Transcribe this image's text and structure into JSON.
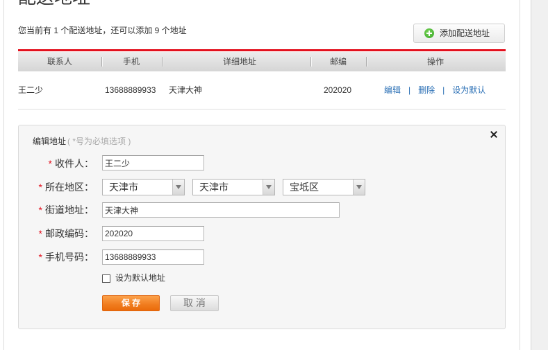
{
  "page": {
    "title": "配送地址"
  },
  "summary": {
    "text": "您当前有 1 个配送地址，还可以添加 9 个地址"
  },
  "add_button": {
    "label": "添加配送地址",
    "icon": "plus-circle-icon"
  },
  "table": {
    "headers": [
      "联系人",
      "手机",
      "详细地址",
      "邮编",
      "操作"
    ],
    "action_separator": "|",
    "rows": [
      {
        "name": "王二少",
        "phone": "13688889933",
        "address": "天津大神",
        "zip": "202020",
        "actions": [
          "编辑",
          "删除",
          "设为默认"
        ]
      }
    ]
  },
  "form": {
    "title": "编辑地址",
    "hint": "( *号为必填选项 )",
    "required_mark": "*",
    "fields": {
      "recipient": {
        "label": "收件人：",
        "value": "王二少"
      },
      "region": {
        "label": "所在地区：",
        "province": "天津市",
        "city": "天津市",
        "district": "宝坻区"
      },
      "street": {
        "label": "街道地址：",
        "value": "天津大神"
      },
      "zip": {
        "label": "邮政编码：",
        "value": "202020"
      },
      "phone": {
        "label": "手机号码：",
        "value": "13688889933"
      }
    },
    "default_checkbox": {
      "label": "设为默认地址",
      "checked": false
    },
    "save_label": "保 存",
    "cancel_label": "取 消"
  },
  "icons": {
    "add": "plus-circle-icon",
    "close": "close-icon",
    "dropdown": "chevron-down-icon"
  },
  "colors": {
    "accent_red": "#e3101d",
    "link_blue": "#2a6fb5",
    "save_orange": "#f07c1e",
    "add_green": "#3aa82a"
  }
}
